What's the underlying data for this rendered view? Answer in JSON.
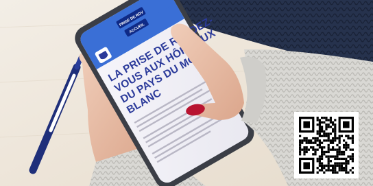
{
  "phone_screen": {
    "header_button_1": "PRISE DE RDV",
    "header_button_2": "ACCUEIL",
    "heading_lines": [
      "LA PRISE DE RENDEZ-",
      "VOUS AUX HÔPITAUX",
      "DU PAYS DU MONT-",
      "BLANC"
    ]
  },
  "qr_code": {
    "icon": "qr-code-icon"
  },
  "colors": {
    "accent_blue": "#2b3a9a",
    "nail_red": "#b81330",
    "sweater_grey": "#d8d7d3",
    "desk": "#efe8dd"
  }
}
